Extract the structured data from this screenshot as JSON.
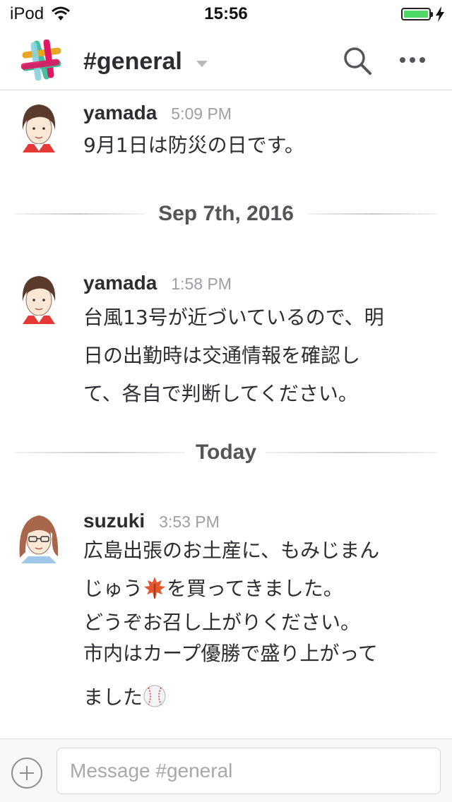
{
  "status_bar": {
    "device": "iPod",
    "time": "15:56",
    "battery_level": 1.0,
    "battery_color": "#4cd964",
    "icons": [
      "wifi-icon",
      "battery-icon",
      "charging-bolt-icon"
    ]
  },
  "header": {
    "channel_title": "#general",
    "icons": [
      "slack-logo",
      "chevron-down-icon",
      "search-icon",
      "more-icon"
    ]
  },
  "messages": [
    {
      "user": "yamada",
      "time": "5:09 PM",
      "lines": [
        "9月1日は防災の日です。"
      ]
    },
    {
      "user": "yamada",
      "time": "1:58 PM",
      "lines": [
        "台風13号が近づいているので、明",
        "日の出勤時は交通情報を確認し",
        "て、各自で判断してください。"
      ]
    },
    {
      "user": "suzuki",
      "time": "3:53 PM",
      "lines": [
        "広島出張のお土産に、もみじまん",
        "じゅう",
        "を買ってきました。",
        "どうぞお召し上がりください。",
        "市内はカープ優勝で盛り上がって",
        "ました"
      ]
    }
  ],
  "dividers": [
    {
      "label": "Sep 7th, 2016"
    },
    {
      "label": "Today"
    }
  ],
  "emoji": [
    "maple-leaf-icon",
    "baseball-icon"
  ],
  "composer": {
    "placeholder": "Message #general",
    "value": "",
    "icons": [
      "add-icon"
    ]
  }
}
